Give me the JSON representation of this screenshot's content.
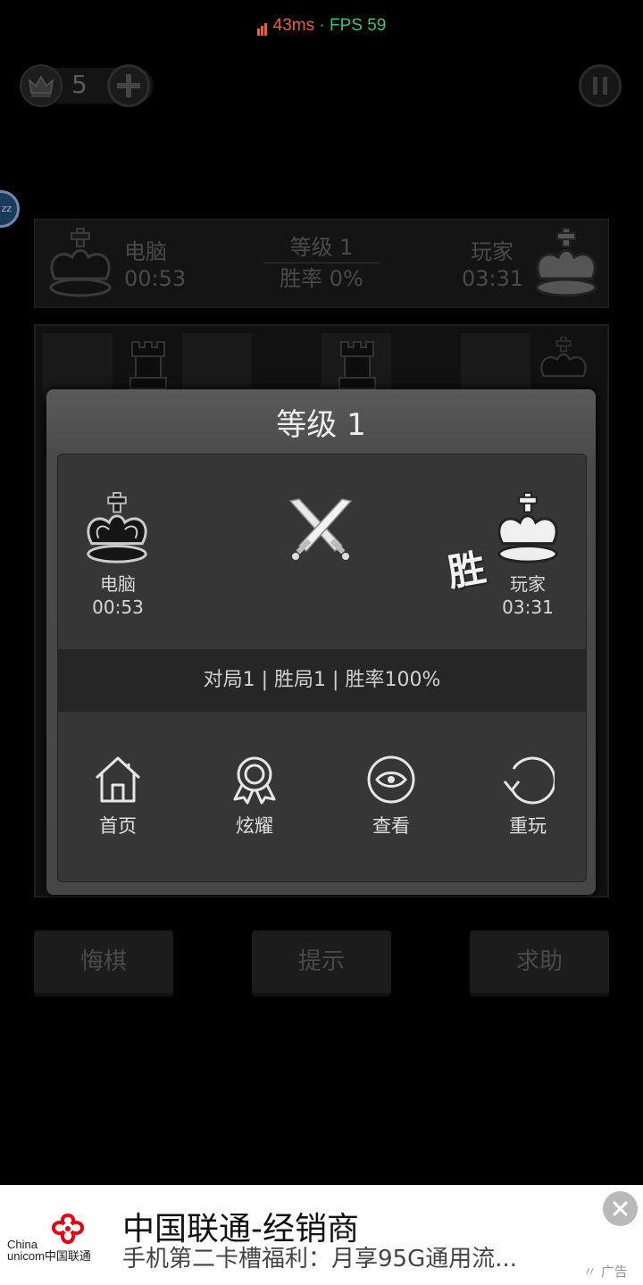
{
  "status": {
    "latency": "43ms",
    "separator": " · ",
    "fps": "FPS 59",
    "latency_color": "#e8603a",
    "fps_color": "#3fc26a"
  },
  "topbar": {
    "crown_count": "5",
    "crown_icon": "crown-icon",
    "plus_icon": "plus-icon",
    "pause_icon": "pause-icon"
  },
  "floating": {
    "label": "zz"
  },
  "hud": {
    "computer_name": "电脑",
    "computer_time": "00:53",
    "level": "等级 1",
    "win_rate": "胜率 0%",
    "player_name": "玩家",
    "player_time": "03:31"
  },
  "game_buttons": {
    "undo": "悔棋",
    "hint": "提示",
    "help": "求助"
  },
  "dialog": {
    "title": "等级 1",
    "left_player": {
      "name": "电脑",
      "time": "00:53"
    },
    "right_player": {
      "name": "玩家",
      "time": "03:31"
    },
    "win_mark": "胜",
    "stats": {
      "games": "对局1",
      "wins": "胜局1",
      "rate": "胜率100%",
      "sep": "|"
    },
    "actions": [
      {
        "label": "首页",
        "icon": "home-icon"
      },
      {
        "label": "炫耀",
        "icon": "medal-icon"
      },
      {
        "label": "查看",
        "icon": "eye-icon"
      },
      {
        "label": "重玩",
        "icon": "replay-icon"
      }
    ]
  },
  "ad": {
    "logo_en_1": "China",
    "logo_en_2": "unicom中国联通",
    "title": "中国联通-经销商",
    "subtitle": "手机第二卡槽福利：月享95G通用流...",
    "tag": "广告"
  }
}
